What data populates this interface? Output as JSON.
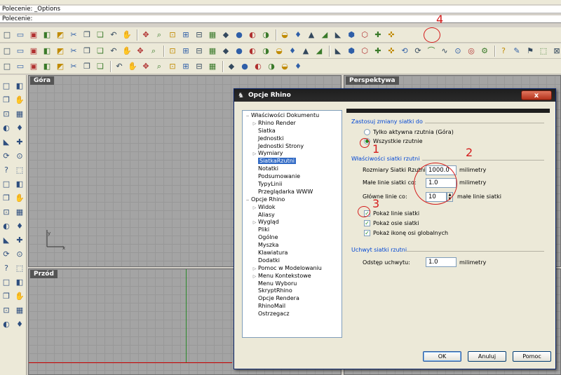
{
  "command_history": "Polecenie: _Options",
  "command_prompt": "Polecenie:",
  "toolbar_icons": {
    "row1": [
      "new-file",
      "open-folder",
      "save",
      "print",
      "import",
      "cut",
      "copy",
      "paste",
      "undo",
      "pan-hand",
      "rotate-view",
      "zoom",
      "zoom-window",
      "zoom-extents",
      "zoom-selected",
      "grid-4-view",
      "car-render",
      "camera",
      "render-preview",
      "bulb",
      "layer-stack",
      "color-wheel",
      "material-sphere",
      "render-sphere",
      "ball",
      "pen",
      "options-gear",
      "properties",
      "help"
    ],
    "row2": [
      "point",
      "curve-polyline",
      "polygon",
      "box-solid",
      "sphere-solid",
      "surface",
      "extrude",
      "boolean",
      "array",
      "mesh",
      "transform",
      "join",
      "explode",
      "trim",
      "split",
      "offset",
      "fillet",
      "chamfer",
      "blend",
      "project",
      "pipe",
      "analyze",
      "dimension",
      "text",
      "block",
      "group",
      "layer",
      "hide",
      "show",
      "lock",
      "unlock",
      "cplane",
      "snap",
      "ortho",
      "planar",
      "osnap",
      "record",
      "history",
      "filter",
      "render-mesh",
      "materials",
      "lights"
    ],
    "row3": [
      "arc",
      "spline",
      "freeform",
      "sketch",
      "hatch",
      "cut-plane",
      "cube",
      "move-gizmo",
      "connect",
      "cage",
      "edit-points",
      "control-points",
      "knot",
      "curvature",
      "zebra",
      "env-map",
      "draft-angle",
      "curv-graph",
      "deviation",
      "volume",
      "area",
      "mass"
    ]
  },
  "left_toolbar_icons": [
    "select",
    "point",
    "polyline",
    "point-cloud",
    "circle",
    "ellipse",
    "arc",
    "circle-2",
    "rectangle",
    "spline",
    "polygon",
    "curve-offset",
    "surface-patch",
    "sphere",
    "box",
    "cylinder",
    "torus",
    "mesh",
    "extrude",
    "revolve",
    "boolean-union",
    "split",
    "fillet-edge",
    "chamfer",
    "shell",
    "cap",
    "loft",
    "sweep",
    "network",
    "trim-surface",
    "text-object",
    "dimension-object",
    "cage-edit",
    "gumball",
    "vertical-dim",
    "surface-box"
  ],
  "viewports": {
    "top": "Góra",
    "perspective": "Perspektywa",
    "front": "Przód"
  },
  "axis": {
    "x": "x",
    "y": "y"
  },
  "dialog": {
    "title": "Opcje Rhino",
    "close_label": "x",
    "tree": [
      {
        "label": "Właściwości Dokumentu",
        "level": 0,
        "expander": "−"
      },
      {
        "label": "Rhino Render",
        "level": 1,
        "expander": "▷"
      },
      {
        "label": "Siatka",
        "level": 1,
        "expander": ""
      },
      {
        "label": "Jednostki",
        "level": 1,
        "expander": ""
      },
      {
        "label": "Jednostki Strony",
        "level": 1,
        "expander": ""
      },
      {
        "label": "Wymiary",
        "level": 1,
        "expander": "▷"
      },
      {
        "label": "SiatkaRzutni",
        "level": 1,
        "expander": "",
        "selected": true
      },
      {
        "label": "Notatki",
        "level": 1,
        "expander": ""
      },
      {
        "label": "Podsumowanie",
        "level": 1,
        "expander": ""
      },
      {
        "label": "TypyLinii",
        "level": 1,
        "expander": ""
      },
      {
        "label": "Przeglądarka WWW",
        "level": 1,
        "expander": ""
      },
      {
        "label": "Opcje Rhino",
        "level": 0,
        "expander": "−"
      },
      {
        "label": "Widok",
        "level": 1,
        "expander": "▷"
      },
      {
        "label": "Aliasy",
        "level": 1,
        "expander": ""
      },
      {
        "label": "Wygląd",
        "level": 1,
        "expander": "▷"
      },
      {
        "label": "Pliki",
        "level": 1,
        "expander": ""
      },
      {
        "label": "Ogólne",
        "level": 1,
        "expander": ""
      },
      {
        "label": "Myszka",
        "level": 1,
        "expander": ""
      },
      {
        "label": "Klawiatura",
        "level": 1,
        "expander": ""
      },
      {
        "label": "Dodatki",
        "level": 1,
        "expander": ""
      },
      {
        "label": "Pomoc w Modelowaniu",
        "level": 1,
        "expander": "▷"
      },
      {
        "label": "Menu Kontekstowe",
        "level": 1,
        "expander": "▷"
      },
      {
        "label": "Menu Wyboru",
        "level": 1,
        "expander": ""
      },
      {
        "label": "SkryptRhino",
        "level": 1,
        "expander": ""
      },
      {
        "label": "Opcje Rendera",
        "level": 1,
        "expander": ""
      },
      {
        "label": "RhinoMail",
        "level": 1,
        "expander": ""
      },
      {
        "label": "Ostrzegacz",
        "level": 1,
        "expander": ""
      }
    ],
    "apply_section": {
      "title": "Zastosuj zmiany siatki do",
      "option_active": "Tylko aktywna rzutnia (Góra)",
      "option_all": "Wszystkie rzutnie",
      "selected": "all"
    },
    "grid_section": {
      "title": "Właściwości siatki rzutni",
      "size_label": "Rozmiary Siatki Rzutni:",
      "size_value": "1000.0",
      "size_unit": "milimetry",
      "minor_label": "Małe linie siatki co:",
      "minor_value": "1.0",
      "minor_unit": "milimetry",
      "major_label": "Główne linie co:",
      "major_value": "10",
      "major_unit": "małe linie siatki",
      "show_lines_label": "Pokaż linie siatki",
      "show_lines": true,
      "show_axes_label": "Pokaż osie siatki",
      "show_axes": true,
      "show_world_label": "Pokaż ikonę osi globalnych",
      "show_world": true
    },
    "snap_section": {
      "title": "Uchwyt siatki rzutni",
      "snap_label": "Odstęp uchwytu:",
      "snap_value": "1.0",
      "snap_unit": "milimetry"
    },
    "buttons": {
      "ok": "OK",
      "cancel": "Anuluj",
      "help": "Pomoc"
    }
  },
  "annotations": [
    "1",
    "2",
    "3",
    "4"
  ],
  "colors": {
    "annotation": "#d41c1c",
    "selection": "#316ac5",
    "section_title": "#0046d5"
  }
}
